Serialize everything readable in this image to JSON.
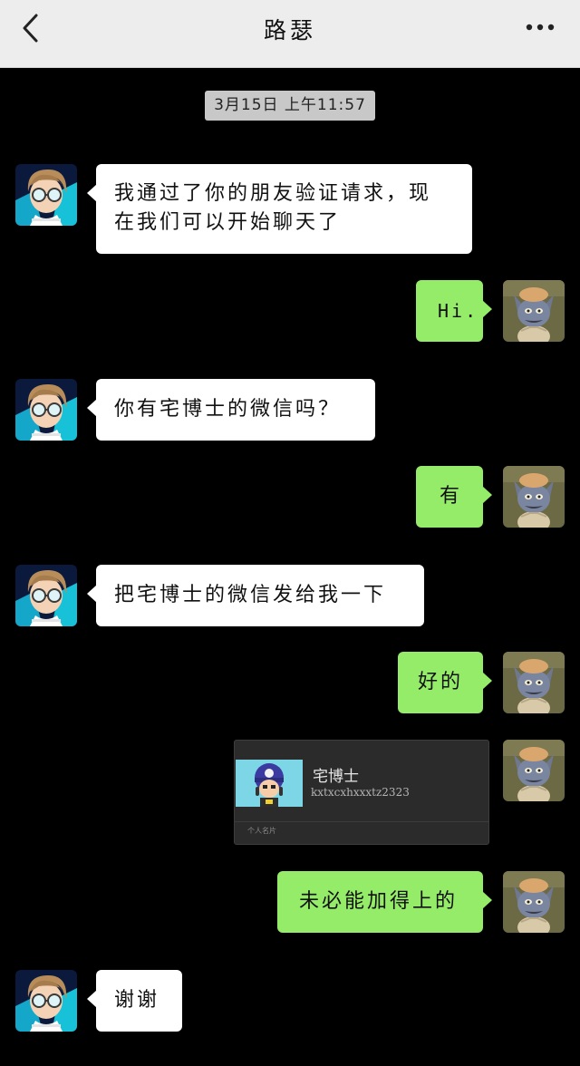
{
  "header": {
    "title": "路瑟",
    "back_icon": "chevron-left-icon",
    "more_icon": "more-dots-icon",
    "background": "#ededed"
  },
  "chat": {
    "timestamp": "3月15日 上午11:57",
    "messages": [
      {
        "side": "left",
        "lines": [
          "我通过了你的朋友验证请求，现",
          "在我们可以开始聊天了"
        ]
      },
      {
        "side": "right",
        "lines": [
          "Hi."
        ]
      },
      {
        "side": "left",
        "lines": [
          "你有宅博士的微信吗？"
        ]
      },
      {
        "side": "right",
        "lines": [
          "有"
        ]
      },
      {
        "side": "left",
        "lines": [
          "把宅博士的微信发给我一下"
        ]
      },
      {
        "side": "right",
        "lines": [
          "好的"
        ]
      },
      {
        "side": "right",
        "type": "contact-card",
        "card": {
          "name": "宅博士",
          "id": "kxtxcxhxxxtz2323",
          "footer": "个人名片"
        }
      },
      {
        "side": "right",
        "lines": [
          "未必能加得上的"
        ]
      },
      {
        "side": "left",
        "lines": [
          "谢谢"
        ]
      }
    ]
  },
  "colors": {
    "background": "#000000",
    "incoming_bubble": "#ffffff",
    "outgoing_bubble": "#95ec69",
    "timestamp_bg": "#c8c8c8"
  }
}
